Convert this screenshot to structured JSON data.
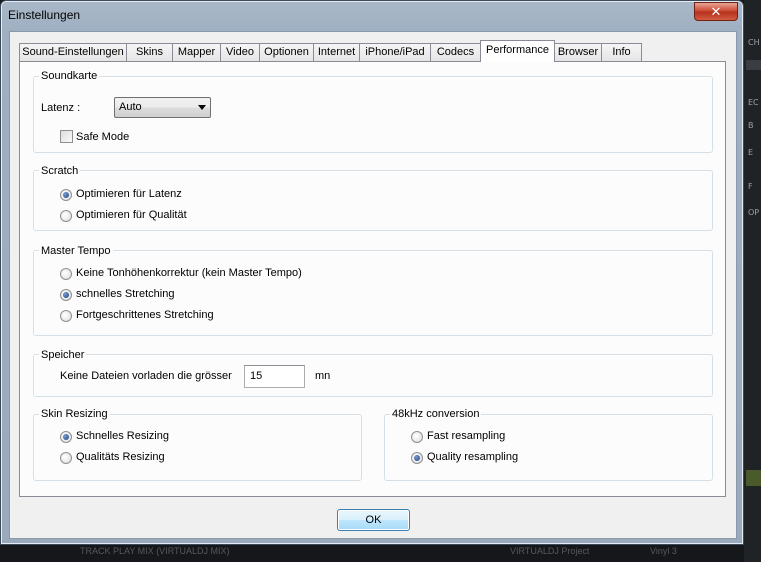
{
  "window": {
    "title": "Einstellungen",
    "close_glyph": "✕"
  },
  "tabs": [
    {
      "label": "Sound-Einstellungen"
    },
    {
      "label": "Skins"
    },
    {
      "label": "Mapper"
    },
    {
      "label": "Video"
    },
    {
      "label": "Optionen"
    },
    {
      "label": "Internet"
    },
    {
      "label": "iPhone/iPad"
    },
    {
      "label": "Codecs"
    },
    {
      "label": "Performance"
    },
    {
      "label": "Browser"
    },
    {
      "label": "Info"
    }
  ],
  "active_tab": "Performance",
  "soundkarte": {
    "title": "Soundkarte",
    "latency_label": "Latenz :",
    "latency_value": "Auto",
    "safe_mode_label": "Safe Mode",
    "safe_mode_checked": false
  },
  "scratch": {
    "title": "Scratch",
    "options": [
      {
        "label": "Optimieren für Latenz",
        "checked": true
      },
      {
        "label": "Optimieren für Qualität",
        "checked": false
      }
    ]
  },
  "master_tempo": {
    "title": "Master Tempo",
    "options": [
      {
        "label": "Keine Tonhöhenkorrektur (kein Master Tempo)",
        "checked": false
      },
      {
        "label": "schnelles Stretching",
        "checked": true
      },
      {
        "label": "Fortgeschrittenes Stretching",
        "checked": false
      }
    ]
  },
  "speicher": {
    "title": "Speicher",
    "preload_label": "Keine Dateien vorladen die grösser",
    "preload_value": "15",
    "unit": "mn"
  },
  "skin_resizing": {
    "title": "Skin Resizing",
    "options": [
      {
        "label": "Schnelles Resizing",
        "checked": true
      },
      {
        "label": "Qualitäts Resizing",
        "checked": false
      }
    ]
  },
  "conversion_48k": {
    "title": "48kHz conversion",
    "options": [
      {
        "label": "Fast resampling",
        "checked": false
      },
      {
        "label": "Quality resampling",
        "checked": true
      }
    ]
  },
  "ok_label": "OK",
  "background_fragments": {
    "right_edge": [
      "CH",
      "EC",
      "B",
      "E",
      "F",
      "OP"
    ],
    "bottom": [
      "TRACK PLAY MIX (VIRTUALDJ MIX)",
      "VIRTUALDJ Project",
      "Vinyl 3"
    ]
  }
}
